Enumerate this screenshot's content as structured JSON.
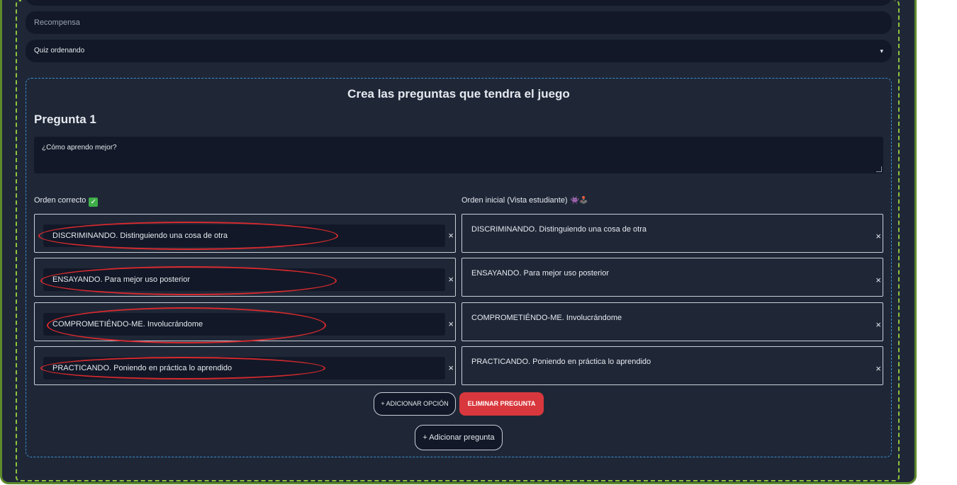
{
  "form": {
    "reward_placeholder": "Recompensa",
    "game_type": {
      "selected": "Quiz ordenando",
      "caret_icon": "caret-down-icon"
    }
  },
  "questions_section": {
    "title": "Crea las preguntas que tendra el juego",
    "question": {
      "title": "Pregunta 1",
      "text": "¿Cómo aprendo mejor?"
    },
    "correct_order_label": "Orden correcto",
    "initial_order_label": "Orden inicial (Vista estudiante)",
    "initial_order_icons": "👾🕹️",
    "correct_options": [
      "DISCRIMINANDO. Distinguiendo una cosa de otra",
      "ENSAYANDO. Para mejor uso posterior",
      "COMPROMETIÉNDO-ME. Involucrándome",
      "PRACTICANDO. Poniendo en práctica lo aprendido"
    ],
    "initial_options": [
      "DISCRIMINANDO. Distinguiendo una cosa de otra",
      "ENSAYANDO. Para mejor uso posterior",
      "COMPROMETIÉNDO-ME. Involucrándome",
      "PRACTICANDO. Poniendo en práctica lo aprendido"
    ],
    "remove_symbol": "×",
    "buttons": {
      "add_option": "+ ADICIONAR OPCIÓN",
      "delete_question": "ELIMINAR PREGUNTA",
      "add_question": "+ Adicionar pregunta"
    }
  },
  "colors": {
    "background": "#1f2737",
    "field": "#121827",
    "outer_border": "#5d8a2b",
    "dashed_green": "#8fc43c",
    "dashed_blue": "#3a8fcf",
    "danger": "#d8383d",
    "annotation": "#d82a2e"
  }
}
